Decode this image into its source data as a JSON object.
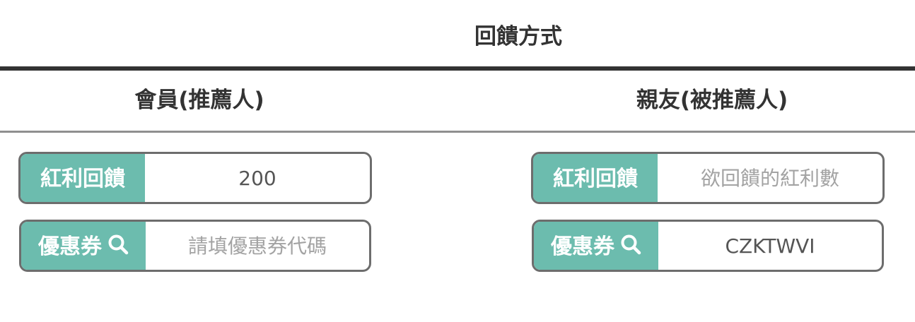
{
  "title": "回饋方式",
  "columns": {
    "member": {
      "heading": "會員(推薦人)",
      "bonus_label": "紅利回饋",
      "bonus_value": "200",
      "bonus_placeholder": "",
      "coupon_label": "優惠券",
      "coupon_value": "",
      "coupon_placeholder": "請填優惠券代碼"
    },
    "friend": {
      "heading": "親友(被推薦人)",
      "bonus_label": "紅利回饋",
      "bonus_value": "",
      "bonus_placeholder": "欲回饋的紅利數",
      "coupon_label": "優惠券",
      "coupon_value": "CZKTWVI",
      "coupon_placeholder": ""
    }
  },
  "icons": {
    "coupon_search": "search-icon"
  },
  "colors": {
    "tag_background": "#6cbcae",
    "border": "#6d6d6d",
    "text": "#333333"
  }
}
